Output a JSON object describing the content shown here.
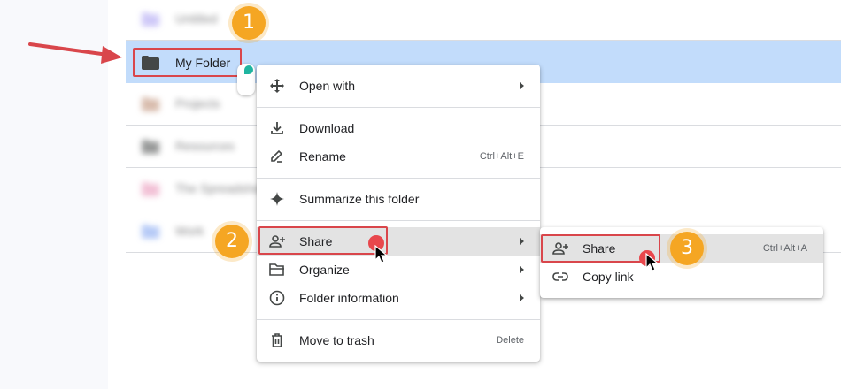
{
  "files": {
    "rows": [
      {
        "name": "Untitled",
        "icon": "folder-icon",
        "color": "#a79cf2",
        "blurred": true
      },
      {
        "name": "My Folder",
        "icon": "folder-icon",
        "color": "#444746",
        "blurred": false,
        "selected": true
      },
      {
        "name": "Projects",
        "icon": "folder-icon",
        "color": "#b9866b",
        "blurred": true
      },
      {
        "name": "Resources",
        "icon": "folder-icon",
        "color": "#444746",
        "blurred": true
      },
      {
        "name": "The Spreadsheet",
        "icon": "folder-icon",
        "color": "#e88fb5",
        "blurred": true
      },
      {
        "name": "Work",
        "icon": "folder-icon",
        "color": "#7a9ff0",
        "blurred": true
      }
    ]
  },
  "context_menu": {
    "items": [
      {
        "label": "Open with",
        "icon": "move-arrows-icon",
        "submenu": true,
        "shortcut": ""
      },
      {
        "label": "Download",
        "icon": "download-icon",
        "submenu": false,
        "shortcut": ""
      },
      {
        "label": "Rename",
        "icon": "rename-pen-icon",
        "submenu": false,
        "shortcut": "Ctrl+Alt+E"
      },
      {
        "label": "Summarize this folder",
        "icon": "sparkle-icon",
        "submenu": false,
        "shortcut": ""
      },
      {
        "label": "Share",
        "icon": "person-add-icon",
        "submenu": true,
        "shortcut": "",
        "hovered": true
      },
      {
        "label": "Organize",
        "icon": "folder-open-icon",
        "submenu": true,
        "shortcut": ""
      },
      {
        "label": "Folder information",
        "icon": "info-icon",
        "submenu": true,
        "shortcut": ""
      },
      {
        "label": "Move to trash",
        "icon": "trash-icon",
        "submenu": false,
        "shortcut": "Delete"
      }
    ]
  },
  "submenu": {
    "items": [
      {
        "label": "Share",
        "icon": "person-add-icon",
        "shortcut": "Ctrl+Alt+A",
        "hovered": true
      },
      {
        "label": "Copy link",
        "icon": "link-icon",
        "shortcut": ""
      }
    ]
  },
  "annotations": {
    "step1": "1",
    "step2": "2",
    "step3": "3",
    "highlight_color": "#d9464b",
    "badge_color": "#f5a623",
    "arrow_color": "#d9464b"
  },
  "colors": {
    "selected_row": "#c2dcfb",
    "menu_hover": "#e3e3e3"
  }
}
